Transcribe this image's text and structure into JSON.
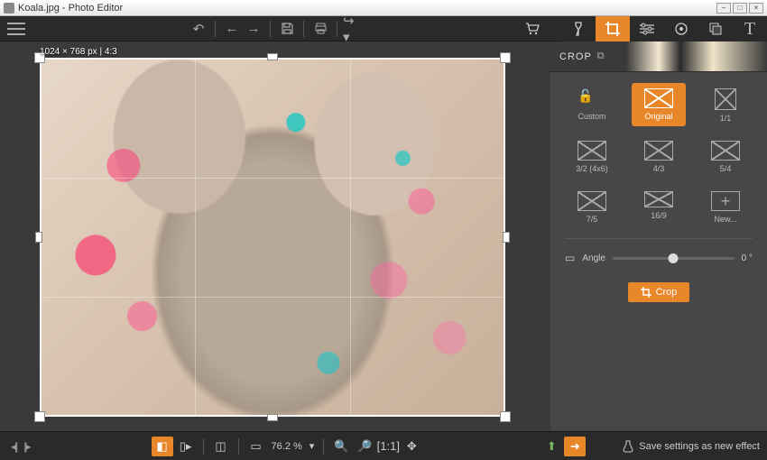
{
  "window": {
    "title": "Koala.jpg - Photo Editor"
  },
  "canvas": {
    "dimensions_label": "1024 × 768 px | 4:3"
  },
  "crop_panel": {
    "title": "CROP",
    "ratios": [
      {
        "id": "custom",
        "label": "Custom",
        "active": false
      },
      {
        "id": "original",
        "label": "Original",
        "active": true
      },
      {
        "id": "1_1",
        "label": "1/1",
        "active": false
      },
      {
        "id": "3_2",
        "label": "3/2 (4x6)",
        "active": false
      },
      {
        "id": "4_3",
        "label": "4/3",
        "active": false
      },
      {
        "id": "5_4",
        "label": "5/4",
        "active": false
      },
      {
        "id": "7_5",
        "label": "7/5",
        "active": false
      },
      {
        "id": "16_9",
        "label": "16/9",
        "active": false
      },
      {
        "id": "new",
        "label": "New...",
        "active": false
      }
    ],
    "angle_label": "Angle",
    "angle_value": "0 °",
    "crop_button": "Crop"
  },
  "bottombar": {
    "zoom": "76.2 %",
    "save_effect": "Save settings as new effect"
  }
}
